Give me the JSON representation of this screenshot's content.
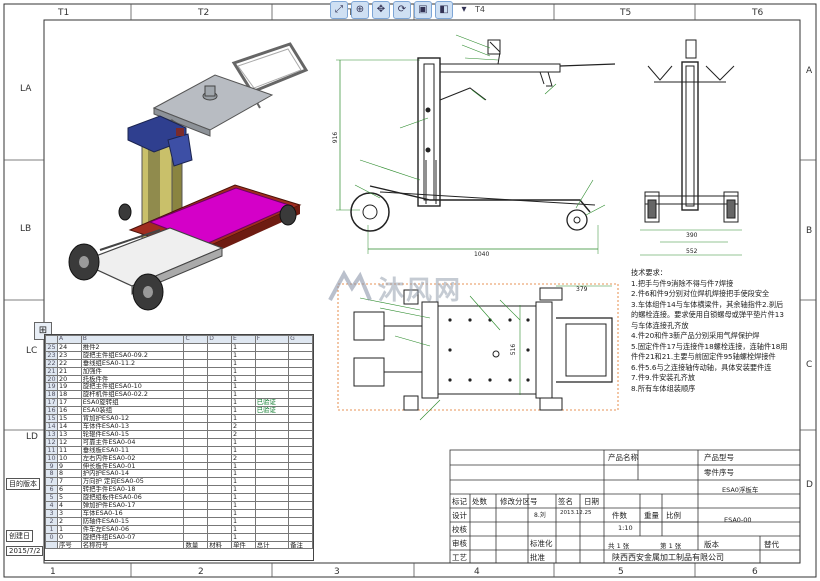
{
  "zones": {
    "top": [
      "T1",
      "T2",
      "T3",
      "T4",
      "T5",
      "T6"
    ],
    "left": [
      "LA",
      "LB",
      "LC",
      "LD"
    ],
    "right": [
      "A",
      "B",
      "C",
      "D"
    ],
    "bottom": [
      "1",
      "2",
      "3",
      "4",
      "5",
      "6"
    ]
  },
  "toolbar": {
    "page_label": "T4"
  },
  "watermark": {
    "text": "沐风网"
  },
  "dimensions": {
    "height": "916",
    "length": "1040",
    "w1": "390",
    "w2": "552",
    "plan_w": "379",
    "plan_h": "516"
  },
  "notes": {
    "title": "技术要求：",
    "lines": [
      "1.把手与件9消除不得与件7焊接",
      "2.件6和件9分别对位焊机焊接把手使段安全",
      "3.车体组件14与车体横梁件，其余轴指件2.刹后",
      "的螺栓连接。要求使用自锁螺母或弹平垫片件13",
      "与车体连接孔齐放",
      "4.件20和件3新产品分别采用气焊保护焊",
      "5.固定件件17与连接件18螺栓连接，连轴件18用",
      "件件21和21.主要与前固定件95轴螺栓焊接件",
      "6.件5.6与之连接轴传动轴，具体安装要件连",
      "7.件9.件安装孔齐放",
      "8.所有车体组装顺序"
    ]
  },
  "bom": {
    "col_letters": [
      "",
      "A",
      "B",
      "C",
      "D",
      "E",
      "F",
      "G"
    ],
    "rows": [
      {
        "n": "25",
        "no": "24",
        "name": "推件2",
        "qty": "1",
        "note": ""
      },
      {
        "n": "23",
        "no": "23",
        "name": "旋把主件组ESA0-09.2",
        "qty": "1",
        "note": ""
      },
      {
        "n": "22",
        "no": "22",
        "name": "垂线组ESA0-11.2",
        "qty": "1",
        "note": ""
      },
      {
        "n": "21",
        "no": "21",
        "name": "加强件",
        "qty": "1",
        "note": ""
      },
      {
        "n": "20",
        "no": "20",
        "name": "托板件件",
        "qty": "1",
        "note": ""
      },
      {
        "n": "19",
        "no": "19",
        "name": "旋把主件组ESA0-10",
        "qty": "1",
        "note": ""
      },
      {
        "n": "18",
        "no": "18",
        "name": "旋杆机件组ESA0-02.2",
        "qty": "1",
        "note": ""
      },
      {
        "n": "17",
        "no": "17",
        "name": "ESA0旋转组",
        "qty": "1",
        "note": "已验证"
      },
      {
        "n": "16",
        "no": "16",
        "name": "ESA0装组",
        "qty": "1",
        "note": "已验证"
      },
      {
        "n": "15",
        "no": "15",
        "name": "背加护ESA0-12",
        "qty": "1",
        "note": ""
      },
      {
        "n": "14",
        "no": "14",
        "name": "车体件ESA0-13",
        "qty": "2",
        "note": ""
      },
      {
        "n": "13",
        "no": "13",
        "name": "轮辊件ESA0-15",
        "qty": "2",
        "note": ""
      },
      {
        "n": "12",
        "no": "12",
        "name": "可靠主件ESA0-04",
        "qty": "1",
        "note": ""
      },
      {
        "n": "11",
        "no": "11",
        "name": "垂线板ESA0-11",
        "qty": "1",
        "note": ""
      },
      {
        "n": "10",
        "no": "10",
        "name": "左右内件ESA0-02",
        "qty": "2",
        "note": ""
      },
      {
        "n": "9",
        "no": "9",
        "name": "伸长板件ESA0-01",
        "qty": "1",
        "note": ""
      },
      {
        "n": "8",
        "no": "8",
        "name": "护内护ESA0-14",
        "qty": "1",
        "note": ""
      },
      {
        "n": "7",
        "no": "7",
        "name": "万向护 定向ESA0-05",
        "qty": "1",
        "note": ""
      },
      {
        "n": "6",
        "no": "6",
        "name": "转把手件ESA0-18",
        "qty": "1",
        "note": ""
      },
      {
        "n": "5",
        "no": "5",
        "name": "旋把组板件ESA0-06",
        "qty": "1",
        "note": ""
      },
      {
        "n": "4",
        "no": "4",
        "name": "弹加护件ESA0-17",
        "qty": "1",
        "note": ""
      },
      {
        "n": "3",
        "no": "3",
        "name": "车体ESA0-16",
        "qty": "1",
        "note": ""
      },
      {
        "n": "2",
        "no": "2",
        "name": "防轴件ESA0-15",
        "qty": "1",
        "note": ""
      },
      {
        "n": "1",
        "no": "1",
        "name": "件车左ESA0-06",
        "qty": "1",
        "note": ""
      },
      {
        "n": "0",
        "no": "0",
        "name": "旋把件组ESA0-07",
        "qty": "1",
        "note": ""
      }
    ],
    "footer": [
      "序号",
      "名称符号",
      "数量",
      "材料",
      "单件",
      "总计",
      "备注"
    ]
  },
  "title_block": {
    "product_type_label": "产品型号",
    "part_no_label": "零件序号",
    "product_name_label": "产品名称",
    "drawing_title": "ESA0浮板车",
    "drawing_code": "ESA0-00",
    "rev_cols": [
      "标记",
      "处数",
      "修改分区号",
      "签名",
      "日期"
    ],
    "design": "设计",
    "design_sign": "8.刘",
    "design_date": "2013.12.25",
    "check": "校核",
    "review": "审核",
    "process": "工艺",
    "std": "标准化",
    "approve": "批准",
    "stage": "阶段标记",
    "weight": "重量",
    "scale": "比例",
    "qty_label": "件数",
    "scale_value": "1:10",
    "sheet": "共 1 张",
    "sheet_no": "第 1 张",
    "company": "陕西西安金属加工制品有限公司",
    "version": "版本",
    "replace": "替代"
  },
  "left_tabs": [
    "目的版本",
    "创建日",
    "2015/7/2"
  ]
}
